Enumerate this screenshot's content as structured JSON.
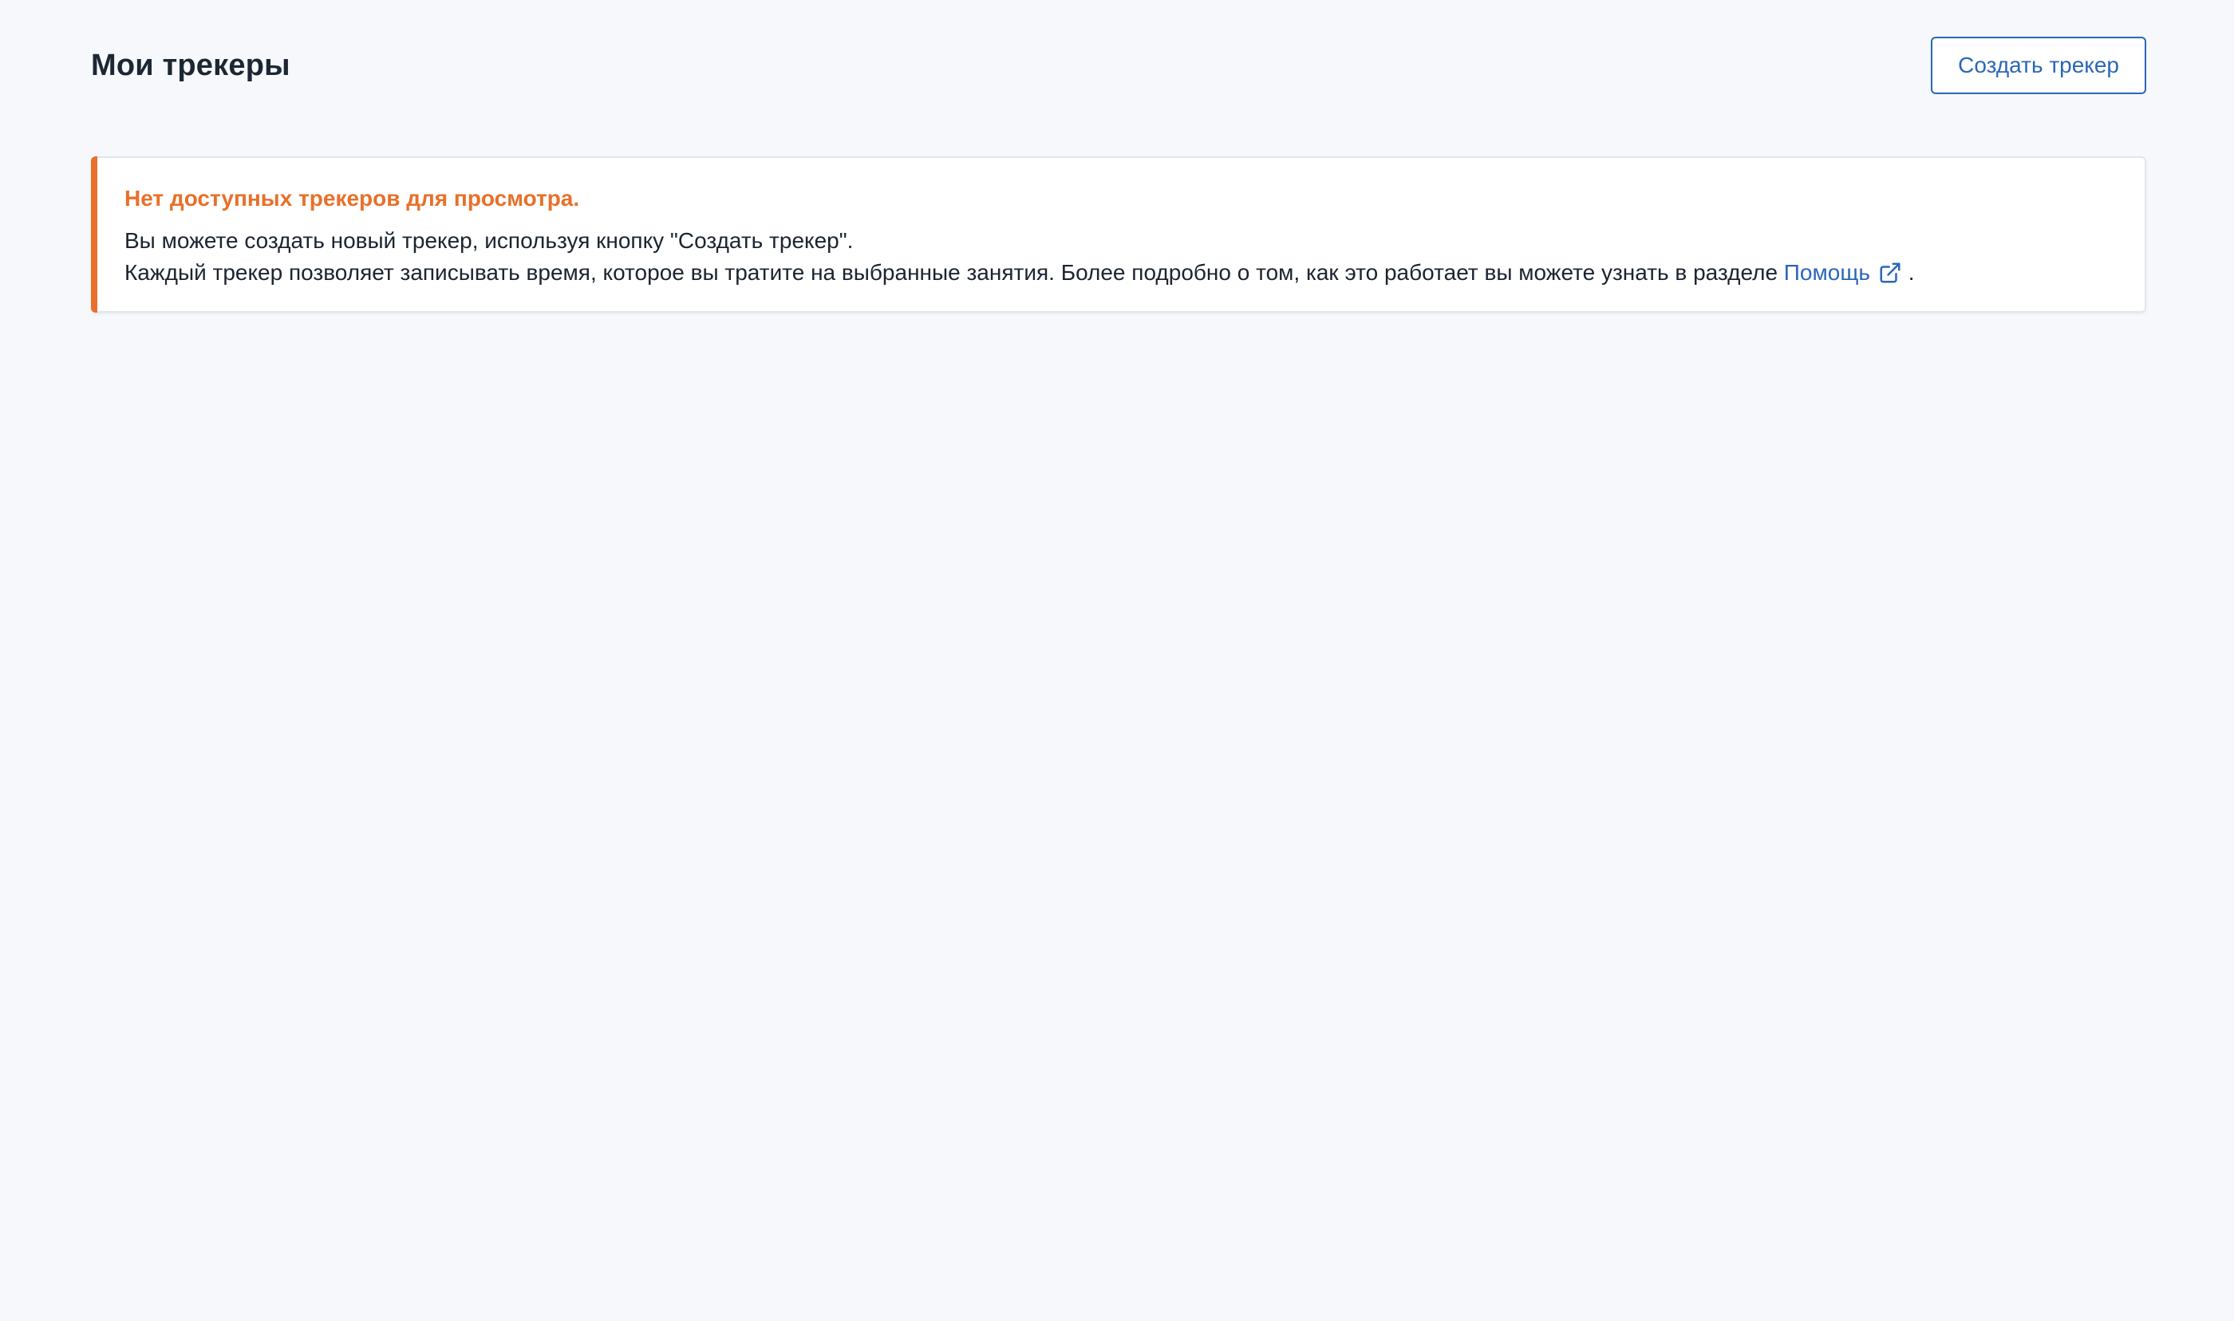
{
  "header": {
    "title": "Мои трекеры",
    "create_button_label": "Создать трекер"
  },
  "notice": {
    "title": "Нет доступных трекеров для просмотра.",
    "line1": "Вы можете создать новый трекер, используя кнопку \"Создать трекер\".",
    "line2_prefix": "Каждый трекер позволяет записывать время, которое вы тратите на выбранные занятия. Более подробно о том, как это работает вы можете узнать в разделе",
    "help_link_label": "Помощь",
    "line2_suffix": ".",
    "link_icon": "external-link-icon"
  },
  "colors": {
    "accent_orange": "#e8702a",
    "link_blue": "#2b66b7",
    "background": "#f6f8fb"
  }
}
